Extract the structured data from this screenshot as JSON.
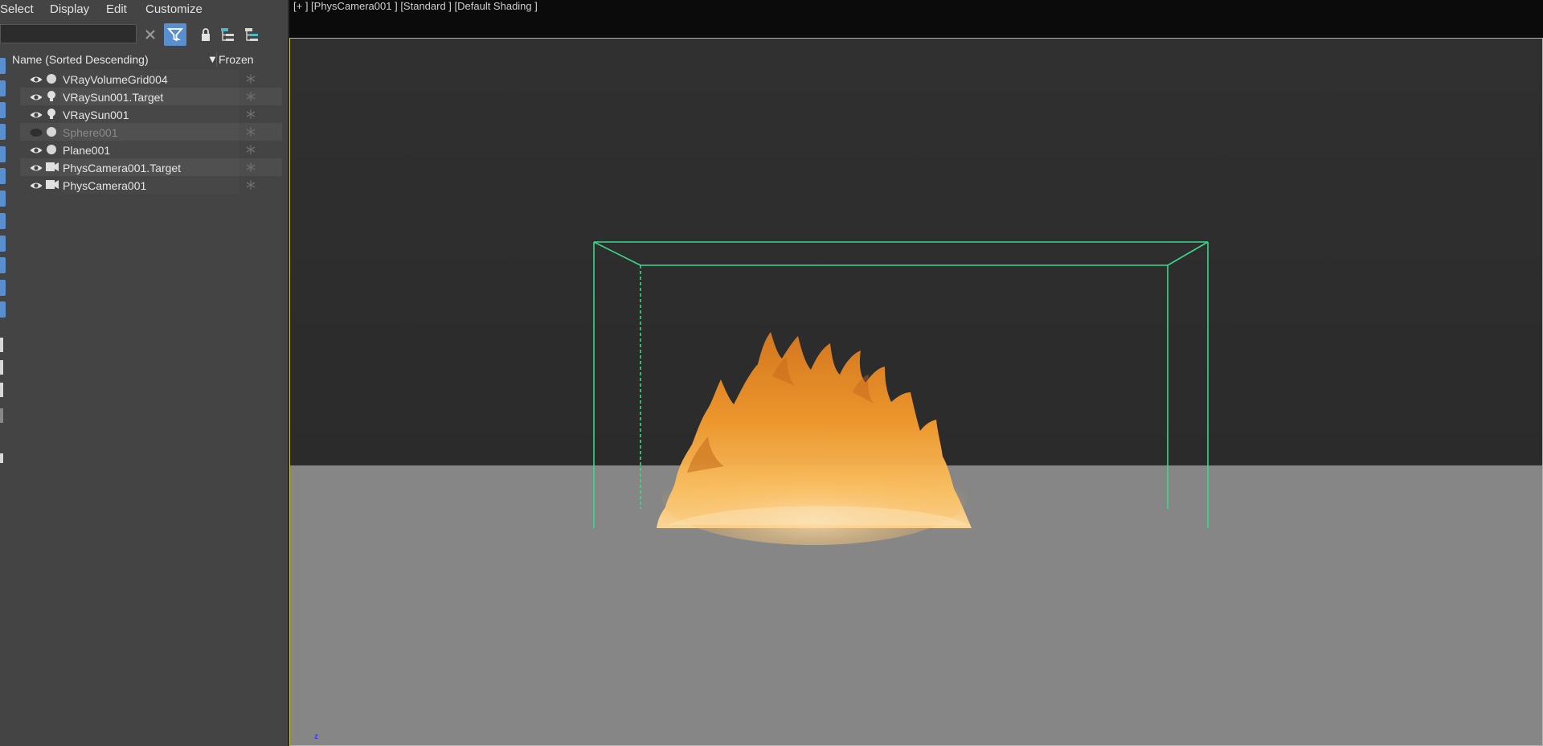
{
  "menu": [
    "Select",
    "Display",
    "Edit",
    "Customize"
  ],
  "toolbar": {
    "search_value": "",
    "icons": [
      "clear-icon",
      "filter-icon",
      "lock-icon",
      "hierarchy-icon",
      "layer-hierarchy-icon"
    ]
  },
  "list": {
    "header_name": "Name (Sorted Descending)",
    "header_frozen": "Frozen",
    "sort_arrow": "▼",
    "rows": [
      {
        "label": "VRayVolumeGrid004",
        "type": "geometry",
        "visible": true
      },
      {
        "label": "VRaySun001.Target",
        "type": "light",
        "visible": true
      },
      {
        "label": "VRaySun001",
        "type": "light",
        "visible": true
      },
      {
        "label": "Sphere001",
        "type": "geometry",
        "visible": false
      },
      {
        "label": "Plane001",
        "type": "geometry",
        "visible": true
      },
      {
        "label": "PhysCamera001.Target",
        "type": "camera",
        "visible": true
      },
      {
        "label": "PhysCamera001",
        "type": "camera",
        "visible": true
      }
    ]
  },
  "viewport": {
    "label": "[+ ] [PhysCamera001 ] [Standard ] [Default Shading ]",
    "axis_label": "z",
    "colors": {
      "sky": "#2e2e2e",
      "ground": "#868686",
      "bounding_box": "#3bd88a",
      "active_border": "#c8c040"
    }
  }
}
